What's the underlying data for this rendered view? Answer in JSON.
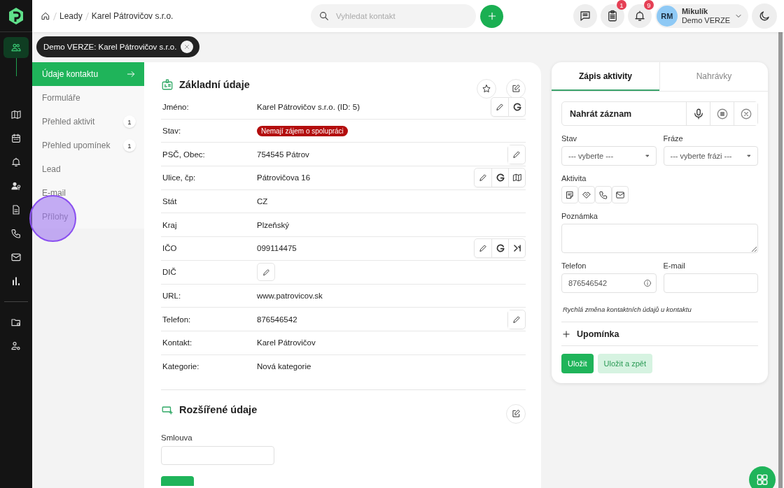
{
  "rail": {
    "items": [
      {
        "selected": true
      },
      {
        "selected": false
      },
      {
        "selected": false
      },
      {
        "selected": false
      },
      {
        "selected": false
      },
      {
        "selected": false
      },
      {
        "selected": false
      },
      {
        "selected": false
      },
      {
        "selected": false
      },
      {
        "selected": false
      },
      {
        "selected": false
      }
    ]
  },
  "breadcrumb": [
    "Leady",
    "Karel Pátrovičov s.r.o."
  ],
  "search": {
    "placeholder": "Vyhledat kontakt"
  },
  "toolbar": {
    "badges": [
      "1",
      "9"
    ]
  },
  "user": {
    "initials": "RM",
    "name": "Mikulík",
    "org": "Demo VERZE"
  },
  "chip": {
    "label": "Demo VERZE: Karel Pátrovičov s.r.o."
  },
  "subnav": [
    {
      "label": "Údaje kontaktu",
      "selected": true
    },
    {
      "label": "Formuláře",
      "selected": false
    },
    {
      "label": "Přehled aktivit",
      "count": "1",
      "selected": false
    },
    {
      "label": "Přehled upomínek",
      "count": "1",
      "selected": false
    },
    {
      "label": "Lead",
      "selected": false
    },
    {
      "label": "E-mail",
      "selected": false
    },
    {
      "label": "Přílohy",
      "selected": false
    }
  ],
  "basic": {
    "title": "Základní údaje",
    "rows": [
      {
        "label": "Jméno:",
        "value": "Karel Pátrovičov s.r.o. (ID: 5)",
        "kind": "text",
        "actions": [
          {
            "kind": "edit"
          },
          {
            "kind": "google"
          }
        ]
      },
      {
        "label": "Stav:",
        "value": "Nemají zájem o spolupráci",
        "kind": "badge",
        "actions": []
      },
      {
        "label": "PSČ, Obec:",
        "value": "754545 Pátrov",
        "kind": "text",
        "actions": [
          {
            "kind": "edit"
          }
        ]
      },
      {
        "label": "Ulice, čp:",
        "value": "Pátrovičova 16",
        "kind": "text",
        "actions": [
          {
            "kind": "edit"
          },
          {
            "kind": "google"
          },
          {
            "kind": "map"
          }
        ]
      },
      {
        "label": "Stát",
        "value": "CZ",
        "kind": "text",
        "actions": []
      },
      {
        "label": "Kraj",
        "value": "Plzeňský",
        "kind": "text",
        "actions": []
      },
      {
        "label": "IČO",
        "value": "099114475",
        "kind": "text",
        "actions": [
          {
            "kind": "edit"
          },
          {
            "kind": "google"
          },
          {
            "kind": "registry"
          }
        ]
      },
      {
        "label": "DIČ",
        "kind": "edit",
        "actions": []
      },
      {
        "label": "URL:",
        "value": "www.patrovicov.sk",
        "kind": "text",
        "actions": []
      },
      {
        "label": "Telefon:",
        "value": "876546542",
        "kind": "text",
        "actions": [
          {
            "kind": "edit"
          }
        ]
      },
      {
        "label": "Kontakt:",
        "value": "Karel Pátrovičov",
        "kind": "text",
        "actions": []
      },
      {
        "label": "Kategorie:",
        "value": "Nová kategorie",
        "kind": "text",
        "actions": []
      }
    ]
  },
  "extended": {
    "title": "Rozšířené údaje",
    "fields": [
      {
        "label": "Smlouva"
      }
    ]
  },
  "panel": {
    "tabs": [
      {
        "label": "Zápis aktivity",
        "selected": true
      },
      {
        "label": "Nahrávky",
        "selected": false
      }
    ],
    "record": "Nahrát záznam",
    "stav": {
      "label": "Stav",
      "placeholder": "--- vyberte ---"
    },
    "fraze": {
      "label": "Fráze",
      "placeholder": "--- vyberte frázi ---"
    },
    "activity": {
      "label": "Aktivita"
    },
    "note": {
      "label": "Poznámka"
    },
    "phone": {
      "label": "Telefon",
      "value": "876546542"
    },
    "email": {
      "label": "E-mail"
    },
    "hint": "Rychlá změna kontaktních údajů u kontaktu",
    "reminder": "Upomínka",
    "buttons": [
      {
        "label": "Uložit",
        "kind": "primary"
      },
      {
        "label": "Uložit a zpět",
        "kind": "secondary"
      }
    ]
  }
}
